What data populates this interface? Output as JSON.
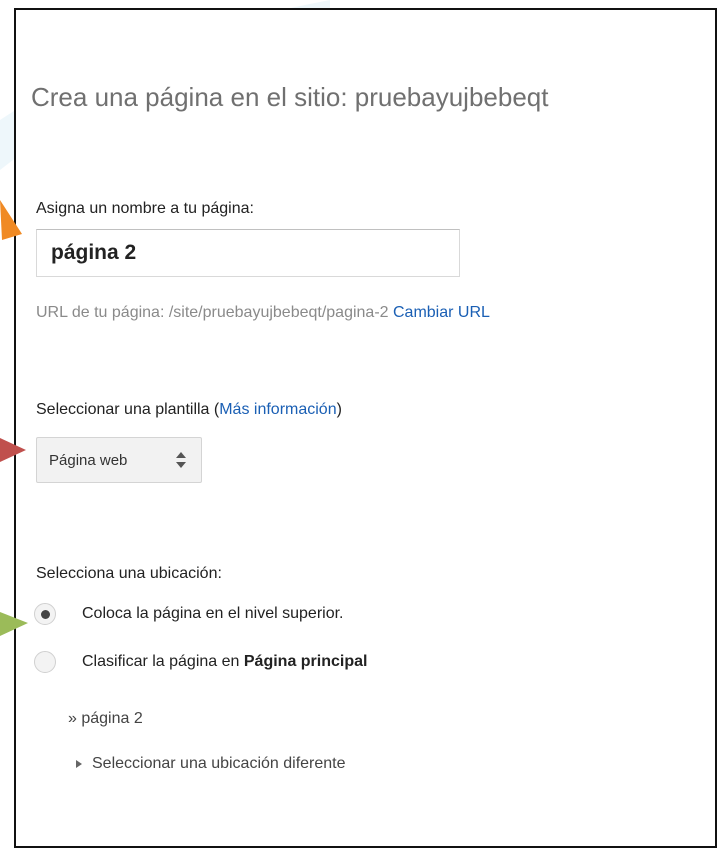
{
  "page": {
    "title": "Crea una página en el sitio: pruebayujbebeqt"
  },
  "name_section": {
    "label": "Asigna un nombre a tu página:",
    "input_value": "página 2",
    "url_prefix": "URL de tu página: /site/pruebayujbebeqt/pagina-2",
    "change_url_link": "Cambiar URL"
  },
  "template_section": {
    "label_prefix": "Seleccionar una plantilla (",
    "more_info_link": "Más información",
    "label_suffix": ")",
    "selected_template": "Página web"
  },
  "location_section": {
    "label": "Selecciona una ubicación:",
    "options": [
      {
        "label": "Coloca la página en el nivel superior.",
        "checked": true
      },
      {
        "label_prefix": "Clasificar la página en ",
        "label_bold": "Página principal",
        "checked": false
      }
    ],
    "breadcrumb": "» página 2",
    "other_location": "Seleccionar una ubicación diferente"
  },
  "colors": {
    "arrow_orange": "#f08a24",
    "arrow_red": "#c0504d",
    "arrow_green": "#9bbb59",
    "link_blue": "#1a5fb4",
    "title_gray": "#707070"
  }
}
